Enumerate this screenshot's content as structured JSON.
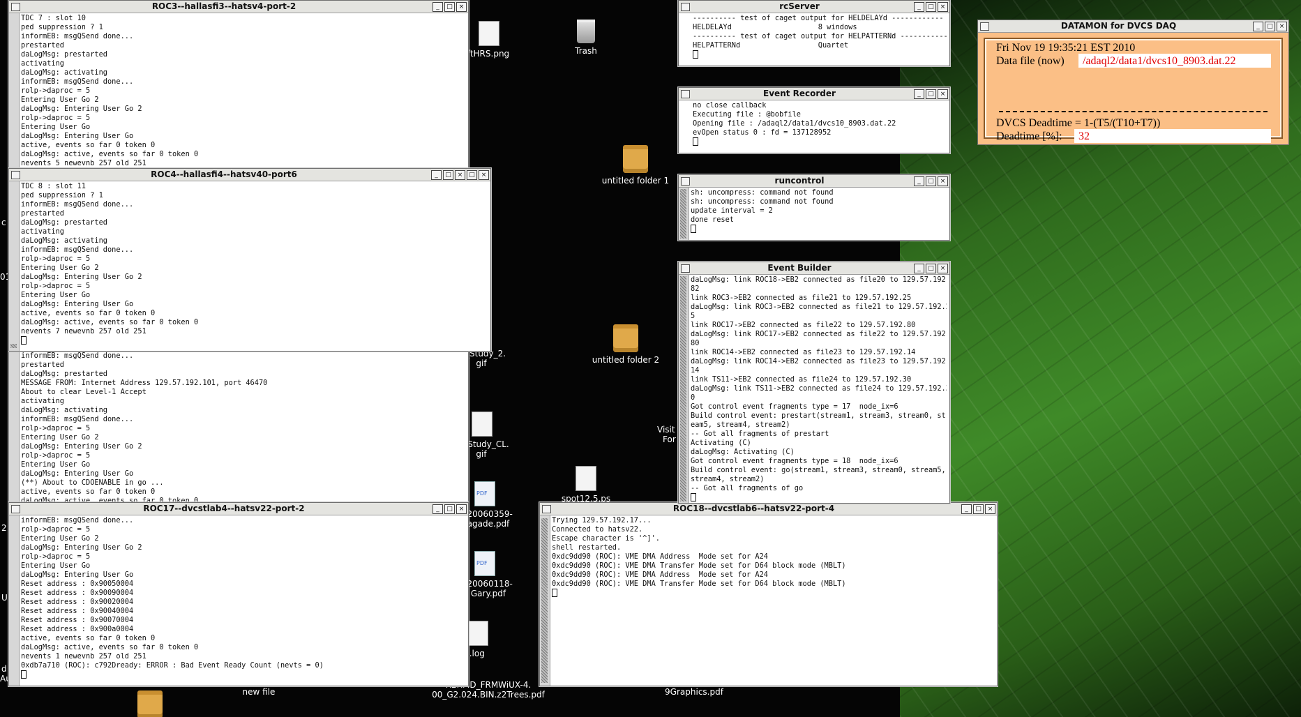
{
  "desktop": {
    "icons": [
      {
        "id": "trash",
        "label": "Trash",
        "kind": "trash"
      },
      {
        "id": "folder1",
        "label": "untitled folder 1",
        "kind": "folder"
      },
      {
        "id": "folder2",
        "label": "untitled folder 2",
        "kind": "folder"
      },
      {
        "id": "fthrs",
        "label": "ftHRS.png",
        "kind": "doc"
      },
      {
        "id": "study2",
        "label": "te_Study_2.\ngif",
        "kind": "doc"
      },
      {
        "id": "studycl",
        "label": "ce_Study_CL.\ngif",
        "kind": "doc"
      },
      {
        "id": "pdf20060359",
        "label": "-20060359-\nagade.pdf",
        "kind": "pdf"
      },
      {
        "id": "pdf20060118",
        "label": "-20060118-\nGary.pdf",
        "kind": "pdf"
      },
      {
        "id": "qlog",
        "label": "q.log",
        "kind": "doc"
      },
      {
        "id": "spot",
        "label": "spot12.5.ps",
        "kind": "doc"
      },
      {
        "id": "newfile",
        "label": "new file",
        "kind": "doc"
      },
      {
        "id": "r2r",
        "label": "R2RMD_FRMWiUX-4.\n00_G2.024.BIN.z2Trees.pdf",
        "kind": "pdf"
      },
      {
        "id": "graphics",
        "label": "9Graphics.pdf",
        "kind": "pdf"
      }
    ],
    "fragments": {
      "visit": "Visit",
      "for": "For",
      "c": "c",
      "d": "d",
      "u": "U",
      "n21": "2",
      "au": "Au",
      "n01": "01"
    }
  },
  "windows": {
    "roc3": {
      "title": "ROC3--hallasfi3--hatsv4-port-2",
      "lines": [
        "TDC 7 : slot 10",
        "ped suppression ? 1",
        "informEB: msgQSend done...",
        "prestarted",
        "daLogMsg: prestarted",
        "activating",
        "daLogMsg: activating",
        "informEB: msgQSend done...",
        "rolp->daproc = 5",
        "Entering User Go 2",
        "daLogMsg: Entering User Go 2",
        "rolp->daproc = 5",
        "Entering User Go",
        "daLogMsg: Entering User Go",
        "active, events so far 0 token 0",
        "daLogMsg: active, events so far 0 token 0",
        "nevents 5 newevnb 257 old 251"
      ]
    },
    "roc4": {
      "title": "ROC4--hallasfi4--hatsv40-port6",
      "lines": [
        "TDC 8 : slot 11",
        "ped suppression ? 1",
        "informEB: msgQSend done...",
        "prestarted",
        "daLogMsg: prestarted",
        "activating",
        "daLogMsg: activating",
        "informEB: msgQSend done...",
        "rolp->daproc = 5",
        "Entering User Go 2",
        "daLogMsg: Entering User Go 2",
        "rolp->daproc = 5",
        "Entering User Go",
        "daLogMsg: Entering User Go",
        "active, events so far 0 token 0",
        "daLogMsg: active, events so far 0 token 0",
        "nevents 7 newevnb 257 old 251"
      ]
    },
    "middle": {
      "lines": [
        "informEB: msgQSend done...",
        "prestarted",
        "daLogMsg: prestarted",
        "MESSAGE FROM: Internet Address 129.57.192.101, port 46470",
        "About to clear Level-1 Accept",
        "activating",
        "daLogMsg: activating",
        "informEB: msgQSend done...",
        "rolp->daproc = 5",
        "Entering User Go 2",
        "daLogMsg: Entering User Go 2",
        "rolp->daproc = 5",
        "Entering User Go",
        "daLogMsg: Entering User Go",
        "(**) About to CDOENABLE in go ...",
        "active, events so far 0 token 0",
        "daLogMsg: active, events so far 0 token 0"
      ]
    },
    "roc17": {
      "title": "ROC17--dvcstlab4--hatsv22-port-2",
      "lines": [
        "informEB: msgQSend done...",
        "rolp->daproc = 5",
        "Entering User Go 2",
        "daLogMsg: Entering User Go 2",
        "rolp->daproc = 5",
        "Entering User Go",
        "daLogMsg: Entering User Go",
        "Reset address : 0x90050004",
        "Reset address : 0x90090004",
        "Reset address : 0x90020004",
        "Reset address : 0x90040004",
        "Reset address : 0x90070004",
        "Reset address : 0x900a0004",
        "active, events so far 0 token 0",
        "daLogMsg: active, events so far 0 token 0",
        "nevents 1 newevnb 257 old 251",
        "0xdb7a710 (ROC): c792Dready: ERROR : Bad Event Ready Count (nevts = 0)"
      ]
    },
    "roc18": {
      "title": "ROC18--dvcstlab6--hatsv22-port-4",
      "lines": [
        "Trying 129.57.192.17...",
        "Connected to hatsv22.",
        "Escape character is '^]'.",
        "shell restarted.",
        "0xdc9dd90 (ROC): VME DMA Address  Mode set for A24",
        "0xdc9dd90 (ROC): VME DMA Transfer Mode set for D64 block mode (MBLT)",
        "0xdc9dd90 (ROC): VME DMA Address  Mode set for A24",
        "0xdc9dd90 (ROC): VME DMA Transfer Mode set for D64 block mode (MBLT)"
      ]
    },
    "rcserver": {
      "title": "rcServer",
      "lines": [
        "---------- test of caget output for HELDELAYd ------------",
        "HELDELAYd                    8 windows",
        "---------- test of caget output for HELPATTERNd ------------",
        "HELPATTERNd                  Quartet"
      ]
    },
    "eventrec": {
      "title": "Event Recorder",
      "lines": [
        "no close callback",
        "Executing file : @bobfile",
        "Opening file : /adaql2/data1/dvcs10_8903.dat.22",
        "evOpen status 0 : fd = 137128952"
      ]
    },
    "runcontrol": {
      "title": "runcontrol",
      "lines": [
        "sh: uncompress: command not found",
        "sh: uncompress: command not found",
        "update interval = 2",
        "done reset"
      ]
    },
    "eventbuilder": {
      "title": "Event Builder",
      "lines": [
        "daLogMsg: link ROC18->EB2 connected as file20 to 129.57.192.",
        "82",
        "link ROC3->EB2 connected as file21 to 129.57.192.25",
        "daLogMsg: link ROC3->EB2 connected as file21 to 129.57.192.2",
        "5",
        "link ROC17->EB2 connected as file22 to 129.57.192.80",
        "daLogMsg: link ROC17->EB2 connected as file22 to 129.57.192.",
        "80",
        "link ROC14->EB2 connected as file23 to 129.57.192.14",
        "daLogMsg: link ROC14->EB2 connected as file23 to 129.57.192.",
        "14",
        "link TS11->EB2 connected as file24 to 129.57.192.30",
        "daLogMsg: link TS11->EB2 connected as file24 to 129.57.192.3",
        "0",
        "Got control event fragments type = 17  node_ix=6",
        "Build control event: prestart(stream1, stream3, stream0, str",
        "eam5, stream4, stream2)",
        "-- Got all fragments of prestart",
        "Activating (C)",
        "daLogMsg: Activating (C)",
        "Got control event fragments type = 18  node_ix=6",
        "Build control event: go(stream1, stream3, stream0, stream5,",
        "stream4, stream2)",
        "-- Got all fragments of go"
      ]
    }
  },
  "datamon": {
    "title": "DATAMON  for DVCS DAQ",
    "datetime": "Fri Nov 19 19:35:21 EST 2010",
    "datafile_label": "Data file (now)",
    "datafile_value": "/adaql2/data1/dvcs10_8903.dat.22",
    "deadtime_formula": "DVCS Deadtime = 1-(T5/(T10+T7))",
    "deadtime_label": "Deadtime [%]:",
    "deadtime_value": "32"
  },
  "colors": {
    "datamon_bg": "#fbbf86",
    "datamon_value": "#e00000",
    "titlebar": "#e4e4e0"
  }
}
